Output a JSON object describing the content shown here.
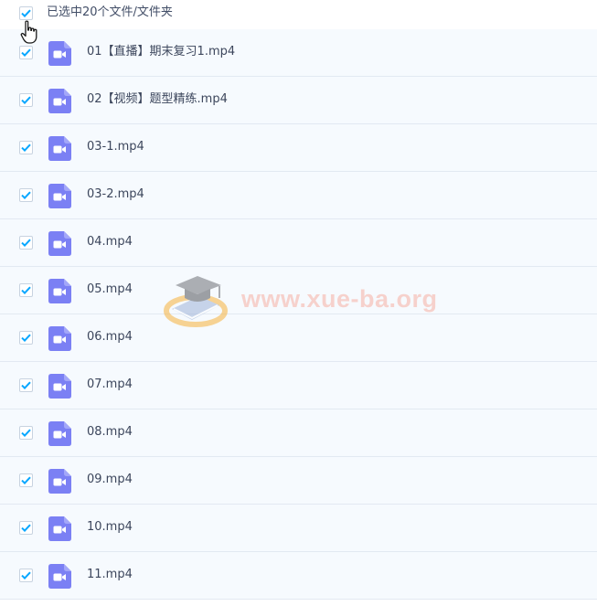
{
  "header": {
    "selected_label": "已选中20个文件/文件夹",
    "checked": true
  },
  "files": [
    {
      "name": "01【直播】期末复习1.mp4",
      "checked": true
    },
    {
      "name": "02【视频】题型精练.mp4",
      "checked": true
    },
    {
      "name": "03-1.mp4",
      "checked": true
    },
    {
      "name": "03-2.mp4",
      "checked": true
    },
    {
      "name": "04.mp4",
      "checked": true
    },
    {
      "name": "05.mp4",
      "checked": true
    },
    {
      "name": "06.mp4",
      "checked": true
    },
    {
      "name": "07.mp4",
      "checked": true
    },
    {
      "name": "08.mp4",
      "checked": true
    },
    {
      "name": "09.mp4",
      "checked": true
    },
    {
      "name": "10.mp4",
      "checked": true
    },
    {
      "name": "11.mp4",
      "checked": true
    }
  ],
  "watermark": {
    "text": "www.xue-ba.org"
  },
  "colors": {
    "check": "#06a7ff",
    "file_icon": "#7b80f4",
    "row_bg": "#f6fafe",
    "row_border": "#e2e9f2"
  },
  "icons": {
    "row_icon": "video-file-icon",
    "checkbox": "checkbox-checked-icon",
    "cursor": "hand-pointer-icon",
    "watermark_logo": "graduation-cap-icon"
  }
}
